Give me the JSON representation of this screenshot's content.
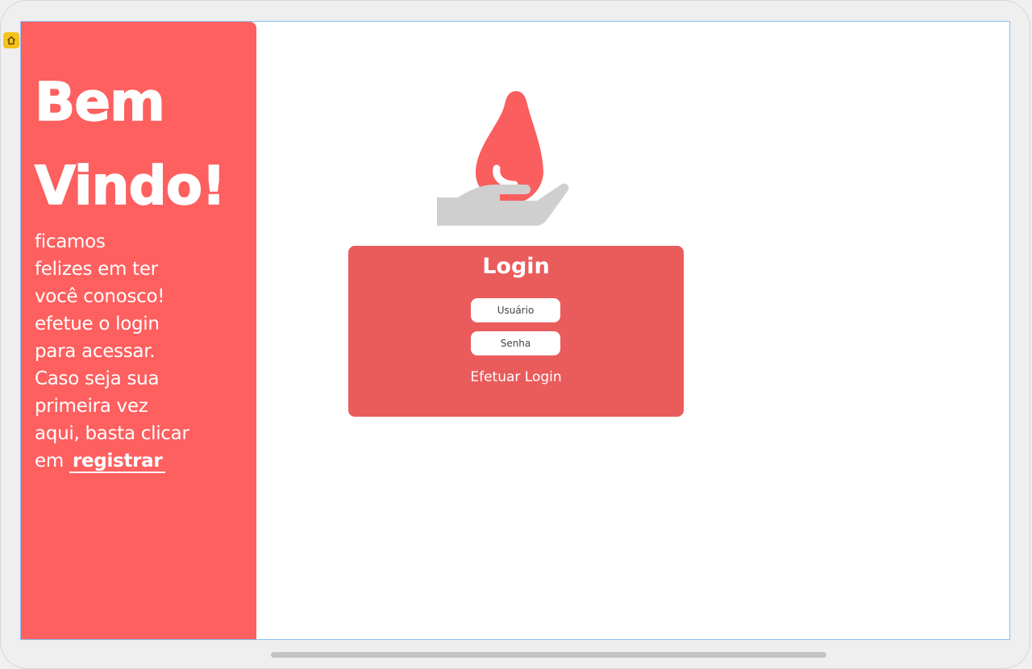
{
  "sidebar": {
    "welcome_line1": "Bem",
    "welcome_line2": "Vindo!",
    "intro_lines": [
      "ficamos",
      "felizes em ter",
      "você conosco!",
      "efetue o login",
      "para acessar.",
      "Caso seja sua",
      "primeira vez",
      "aqui, basta clicar"
    ],
    "intro_last_prefix": "em ",
    "register_label": "registrar"
  },
  "login": {
    "title": "Login",
    "username_placeholder": "Usuário",
    "password_placeholder": "Senha",
    "submit_label": "Efetuar Login"
  },
  "icons": {
    "hero": "blood-drop-in-hand-icon",
    "home_badge": "home-icon"
  },
  "colors": {
    "primary": "#fe5f5f",
    "card": "#ea5b5b",
    "drop": "#fb5e5e",
    "hand": "#cfcfcf",
    "text_on_primary": "#ffffff"
  }
}
